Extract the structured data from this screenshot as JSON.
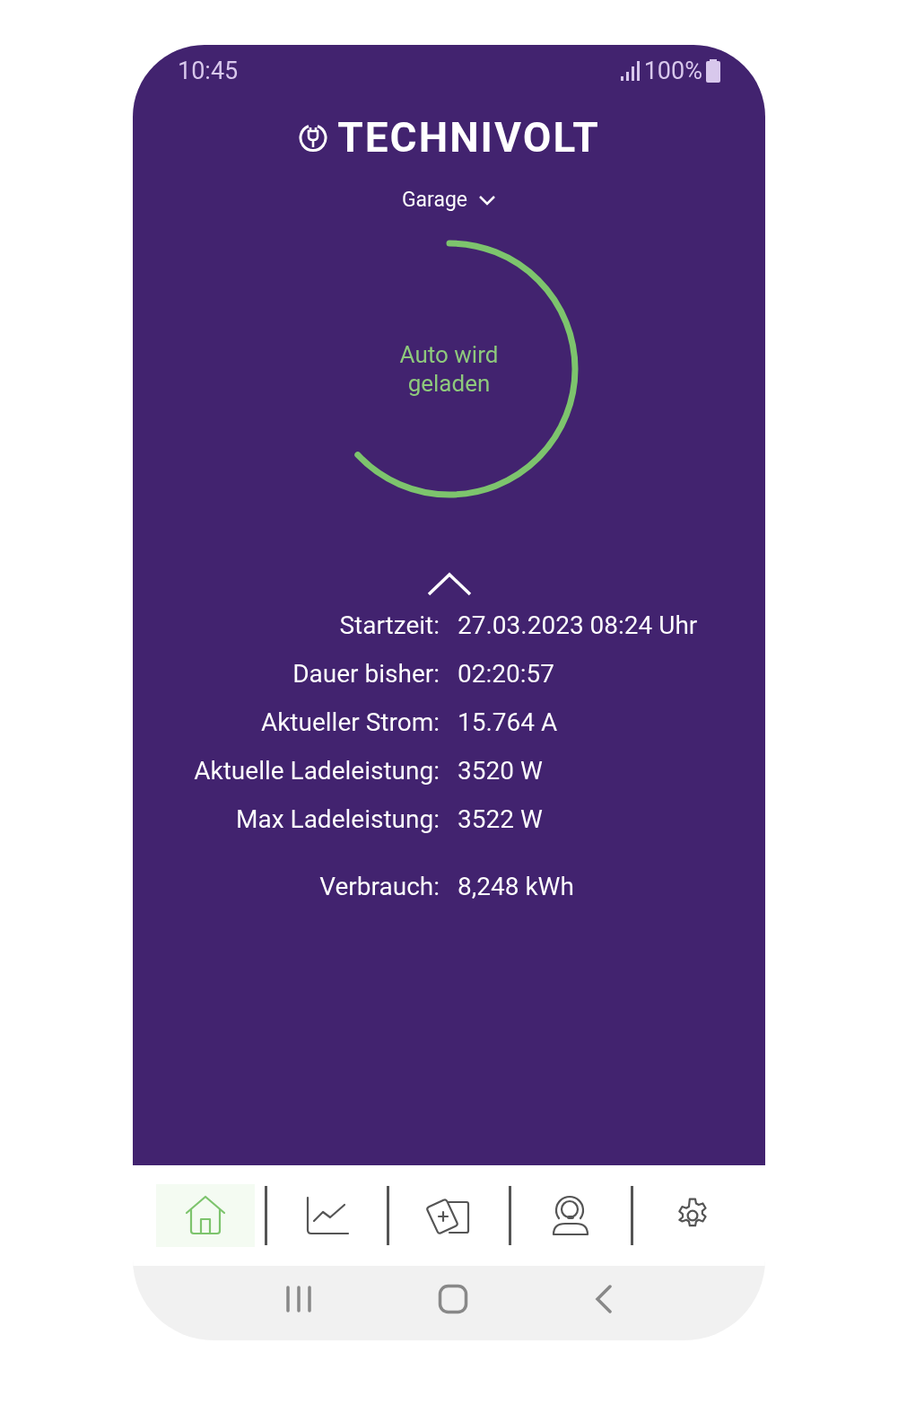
{
  "status_bar": {
    "time": "10:45",
    "battery": "100%"
  },
  "header": {
    "logo": "TECHNIVOLT",
    "location": "Garage"
  },
  "charge": {
    "status": "Auto wird geladen",
    "level": 0.63
  },
  "details": [
    {
      "label": "Startzeit:",
      "value": "27.03.2023 08:24 Uhr"
    },
    {
      "label": "Dauer bisher:",
      "value": "02:20:57"
    },
    {
      "label": "Aktueller Strom:",
      "value": "15.764 A"
    },
    {
      "label": "Aktuelle Ladeleistung:",
      "value": "3520 W"
    },
    {
      "label": "Max Ladeleistung:",
      "value": "3522 W"
    }
  ],
  "total": {
    "label": "Verbrauch:",
    "value": "8,248 kWh"
  },
  "bottom_nav": [
    {
      "kind": "home",
      "selected": true
    },
    {
      "kind": "chart",
      "selected": false
    },
    {
      "kind": "cards",
      "selected": false
    },
    {
      "kind": "support",
      "selected": false
    },
    {
      "kind": "settings",
      "selected": false
    }
  ]
}
